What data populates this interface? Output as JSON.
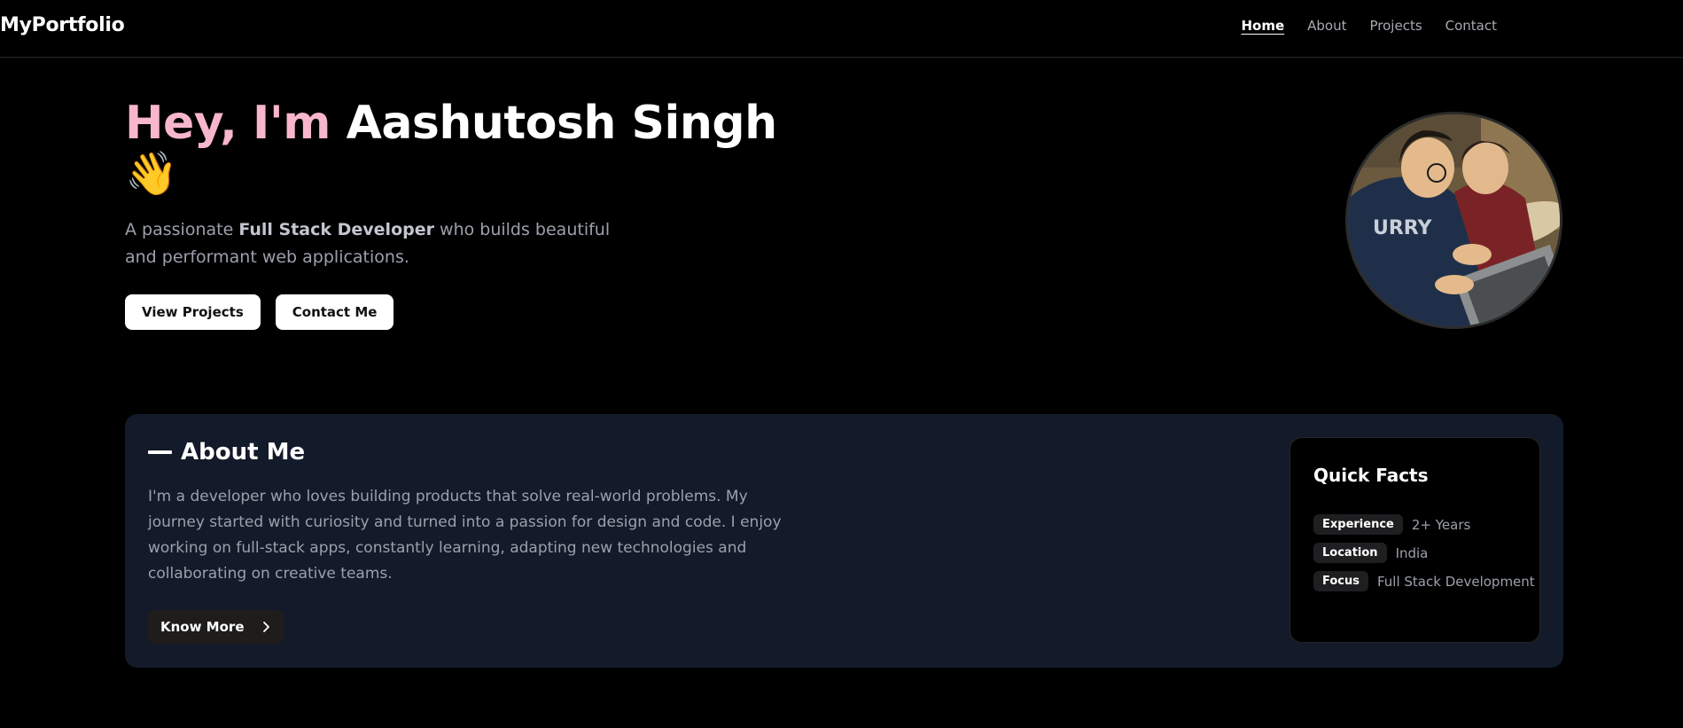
{
  "nav": {
    "brand": "MyPortfolio",
    "links": [
      {
        "label": "Home",
        "active": true
      },
      {
        "label": "About",
        "active": false
      },
      {
        "label": "Projects",
        "active": false
      },
      {
        "label": "Contact",
        "active": false
      }
    ]
  },
  "hero": {
    "greeting": "Hey, I'm",
    "name": "Aashutosh Singh",
    "emoji": "👋",
    "subtitle_prefix": "A passionate",
    "subtitle_highlight": "Full Stack Developer",
    "subtitle_suffix": "who builds beautiful and performant web applications.",
    "buttons": {
      "view_projects": "View Projects",
      "contact_me": "Contact Me"
    }
  },
  "about": {
    "title": "About Me",
    "text": "I'm a developer who loves building products that solve real-world problems. My journey started with curiosity and turned into a passion for design and code. I enjoy working on full-stack apps, constantly learning, adapting new technologies and collaborating on creative teams.",
    "know_more_label": "Know More",
    "quick_facts": {
      "title": "Quick Facts",
      "items": [
        {
          "label": "Experience",
          "value": "2+ Years"
        },
        {
          "label": "Location",
          "value": "India"
        },
        {
          "label": "Focus",
          "value": "Full Stack Development"
        }
      ]
    }
  },
  "colors": {
    "background": "#000000",
    "accent_pink": "#f7b6cb",
    "card_background": "#131a2a",
    "muted_text": "#9ca0ab"
  },
  "icons": {
    "know_more": "chevron-right-icon",
    "wave": "waving-hand-icon"
  }
}
